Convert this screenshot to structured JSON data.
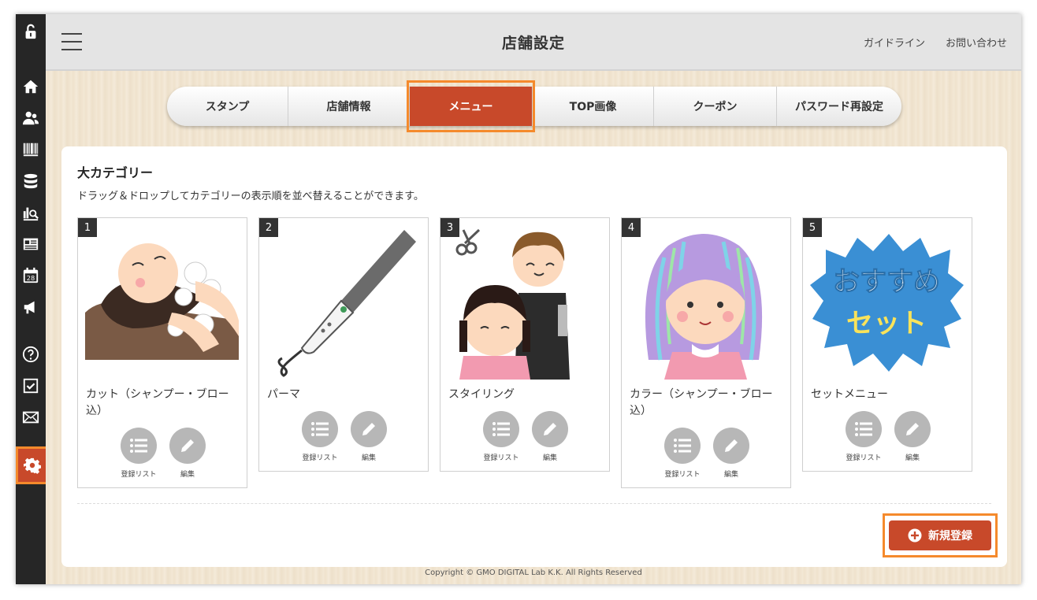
{
  "header": {
    "title": "店舗設定",
    "links": [
      "ガイドライン",
      "お問い合わせ"
    ]
  },
  "tabs": [
    {
      "label": "スタンプ"
    },
    {
      "label": "店舗情報"
    },
    {
      "label": "メニュー",
      "active": true
    },
    {
      "label": "TOP画像"
    },
    {
      "label": "クーポン"
    },
    {
      "label": "パスワード再設定"
    }
  ],
  "sidebar": {
    "icons": [
      "lock-open-icon",
      "home-icon",
      "users-icon",
      "barcode-icon",
      "database-icon",
      "chart-search-icon",
      "document-icon",
      "calendar-icon",
      "megaphone-icon",
      "help-icon",
      "checkbox-icon",
      "mail-icon",
      "gear-icon"
    ],
    "calendar_day": "28"
  },
  "category": {
    "title": "大カテゴリー",
    "description": "ドラッグ＆ドロップしてカテゴリーの表示順を並べ替えることができます。",
    "action_list_label": "登録リスト",
    "action_edit_label": "編集",
    "items": [
      {
        "number": "1",
        "name": "カット（シャンプー・ブロー込）",
        "image": "hair-washing-illustration"
      },
      {
        "number": "2",
        "name": "パーマ",
        "image": "hair-iron-illustration"
      },
      {
        "number": "3",
        "name": "スタイリング",
        "image": "hairdresser-illustration"
      },
      {
        "number": "4",
        "name": "カラー（シャンプー・ブロー込）",
        "image": "colored-hair-girl-illustration"
      },
      {
        "number": "5",
        "name": "セットメニュー",
        "image": "recommended-set-badge",
        "badge_line1": "おすすめ",
        "badge_line2": "セット"
      }
    ]
  },
  "new_button": {
    "label": "新規登録"
  },
  "footer": {
    "copyright": "Copyright © GMO DIGITAL Lab K.K. All Rights Reserved"
  },
  "colors": {
    "accent": "#c8492a",
    "highlight": "#f58a2c",
    "sidebar": "#262626"
  }
}
